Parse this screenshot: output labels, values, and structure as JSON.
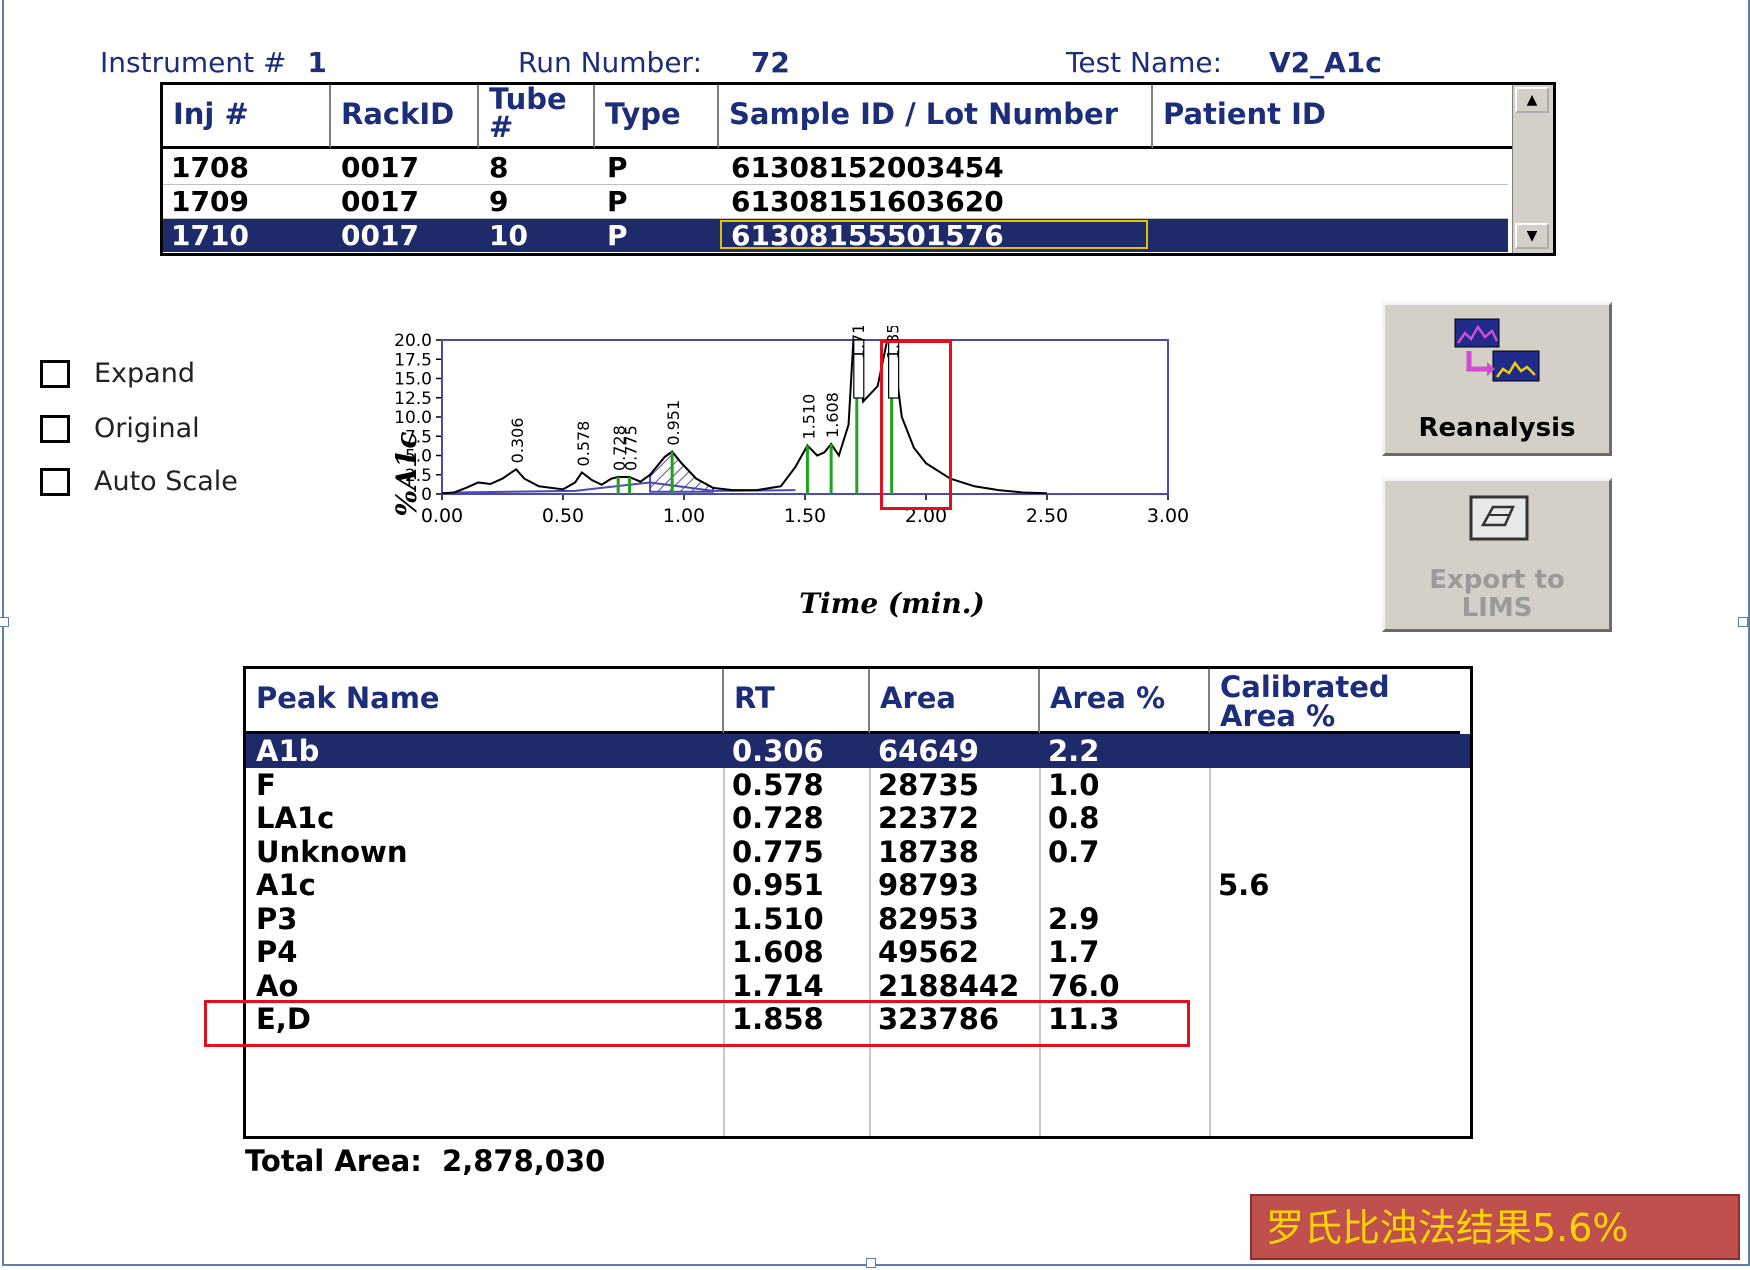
{
  "header": {
    "instrument_label": "Instrument #",
    "instrument_value": "1",
    "run_label": "Run Number:",
    "run_value": "72",
    "test_label": "Test Name:",
    "test_value": "V2_A1c"
  },
  "injections": {
    "columns": [
      "Inj #",
      "RackID",
      "Tube #",
      "Type",
      "Sample ID / Lot Number",
      "Patient ID"
    ],
    "rows": [
      {
        "inj": "1708",
        "rack": "0017",
        "tube": "8",
        "type": "P",
        "sample": "61308152003454",
        "patient": ""
      },
      {
        "inj": "1709",
        "rack": "0017",
        "tube": "9",
        "type": "P",
        "sample": "61308151603620",
        "patient": ""
      },
      {
        "inj": "1710",
        "rack": "0017",
        "tube": "10",
        "type": "P",
        "sample": "61308155501576",
        "patient": ""
      }
    ],
    "selected_row": 2,
    "scroll_up": "▲",
    "scroll_down": "▼"
  },
  "options": {
    "expand": "Expand",
    "original": "Original",
    "auto_scale": "Auto Scale"
  },
  "buttons": {
    "reanalysis": "Reanalysis",
    "export_line1": "Export to",
    "export_line2": "LIMS"
  },
  "chart_data": {
    "type": "line",
    "ylabel": "%A1c",
    "xlabel": "Time (min.)",
    "xlim": [
      0.0,
      3.0
    ],
    "ylim": [
      0.0,
      20.0
    ],
    "x_ticks": [
      "0.00",
      "0.50",
      "1.00",
      "1.50",
      "2.00",
      "2.50",
      "3.00"
    ],
    "y_ticks": [
      "0",
      "2.5",
      "5.0",
      "7.5",
      "10.0",
      "12.5",
      "15.0",
      "17.5",
      "20.0"
    ],
    "peak_labels": [
      {
        "rt": 0.306,
        "label": "0.306",
        "height": 3.2
      },
      {
        "rt": 0.578,
        "label": "0.578",
        "height": 2.8
      },
      {
        "rt": 0.728,
        "label": "0.728",
        "height": 2.2
      },
      {
        "rt": 0.775,
        "label": "0.775",
        "height": 2.2
      },
      {
        "rt": 0.951,
        "label": "0.951",
        "height": 5.5
      },
      {
        "rt": 1.51,
        "label": "1.510",
        "height": 6.3
      },
      {
        "rt": 1.608,
        "label": "1.608",
        "height": 6.5
      },
      {
        "rt": 1.714,
        "label": "1.714",
        "height": 20.0
      },
      {
        "rt": 1.858,
        "label": "1.858",
        "height": 20.0
      }
    ],
    "trace": [
      [
        0.0,
        0.1
      ],
      [
        0.05,
        0.2
      ],
      [
        0.1,
        0.8
      ],
      [
        0.15,
        1.5
      ],
      [
        0.2,
        1.3
      ],
      [
        0.25,
        2.0
      ],
      [
        0.306,
        3.2
      ],
      [
        0.34,
        2.0
      ],
      [
        0.4,
        1.0
      ],
      [
        0.5,
        0.6
      ],
      [
        0.55,
        1.5
      ],
      [
        0.578,
        2.8
      ],
      [
        0.62,
        1.8
      ],
      [
        0.66,
        1.2
      ],
      [
        0.7,
        2.0
      ],
      [
        0.728,
        2.2
      ],
      [
        0.775,
        2.2
      ],
      [
        0.82,
        1.6
      ],
      [
        0.86,
        2.5
      ],
      [
        0.92,
        4.8
      ],
      [
        0.951,
        5.5
      ],
      [
        0.99,
        4.0
      ],
      [
        1.05,
        2.0
      ],
      [
        1.12,
        0.8
      ],
      [
        1.2,
        0.5
      ],
      [
        1.3,
        0.5
      ],
      [
        1.4,
        1.0
      ],
      [
        1.46,
        3.5
      ],
      [
        1.51,
        6.3
      ],
      [
        1.55,
        5.0
      ],
      [
        1.58,
        5.4
      ],
      [
        1.608,
        6.5
      ],
      [
        1.64,
        5.0
      ],
      [
        1.68,
        9.0
      ],
      [
        1.7,
        20.0
      ],
      [
        1.714,
        20.0
      ],
      [
        1.74,
        12.0
      ],
      [
        1.8,
        14.0
      ],
      [
        1.84,
        20.0
      ],
      [
        1.858,
        20.0
      ],
      [
        1.88,
        15.0
      ],
      [
        1.9,
        10.0
      ],
      [
        1.95,
        6.0
      ],
      [
        2.0,
        4.0
      ],
      [
        2.1,
        2.0
      ],
      [
        2.2,
        1.0
      ],
      [
        2.3,
        0.5
      ],
      [
        2.4,
        0.2
      ],
      [
        2.5,
        0.1
      ]
    ]
  },
  "results": {
    "columns": [
      "Peak Name",
      "RT",
      "Area",
      "Area %",
      "Calibrated Area %"
    ],
    "rows": [
      {
        "name": "A1b",
        "rt": "0.306",
        "area": "64649",
        "area_pct": "2.2",
        "cal": ""
      },
      {
        "name": "F",
        "rt": "0.578",
        "area": "28735",
        "area_pct": "1.0",
        "cal": ""
      },
      {
        "name": "LA1c",
        "rt": "0.728",
        "area": "22372",
        "area_pct": "0.8",
        "cal": ""
      },
      {
        "name": "Unknown",
        "rt": "0.775",
        "area": "18738",
        "area_pct": "0.7",
        "cal": ""
      },
      {
        "name": "A1c",
        "rt": "0.951",
        "area": "98793",
        "area_pct": "",
        "cal": "5.6"
      },
      {
        "name": "P3",
        "rt": "1.510",
        "area": "82953",
        "area_pct": "2.9",
        "cal": ""
      },
      {
        "name": "P4",
        "rt": "1.608",
        "area": "49562",
        "area_pct": "1.7",
        "cal": ""
      },
      {
        "name": "Ao",
        "rt": "1.714",
        "area": "2188442",
        "area_pct": "76.0",
        "cal": ""
      },
      {
        "name": "E,D",
        "rt": "1.858",
        "area": "323786",
        "area_pct": "11.3",
        "cal": ""
      }
    ],
    "selected_row": 0,
    "total_label": "Total Area:",
    "total_value": "2,878,030"
  },
  "annotation": {
    "banner": "罗氏比浊法结果5.6%"
  },
  "colors": {
    "header_text": "#1c2d7a",
    "selection": "#1f2a6b",
    "highlight_red": "#e0101c",
    "banner_bg": "#c0504d",
    "banner_text": "#ffd400",
    "chart_axis": "#4a4ab0",
    "peak_marker": "#1fa31f"
  }
}
